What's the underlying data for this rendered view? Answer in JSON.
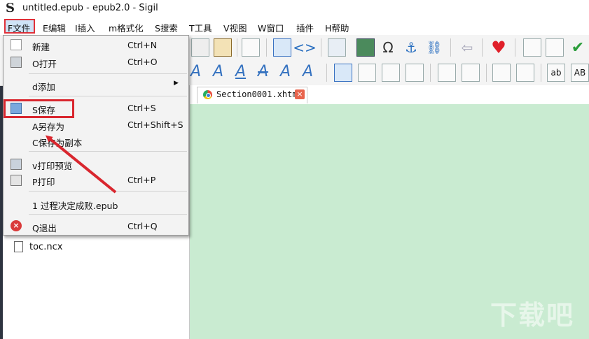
{
  "window": {
    "logo": "S",
    "title": "untitled.epub - epub2.0 - Sigil"
  },
  "menubar": {
    "items": [
      "F文件",
      "E编辑",
      "I插入",
      "m格式化",
      "S搜索",
      "T工具",
      "V视图",
      "W窗口",
      "插件",
      "H帮助"
    ]
  },
  "file_menu": {
    "items": [
      {
        "label": "新建",
        "shortcut": "Ctrl+N"
      },
      {
        "label": "O打开",
        "shortcut": "Ctrl+O"
      },
      {
        "label": "d添加",
        "shortcut": "▶"
      },
      {
        "label": "S保存",
        "shortcut": "Ctrl+S"
      },
      {
        "label": "A另存为",
        "shortcut": "Ctrl+Shift+S"
      },
      {
        "label": "C保存为副本",
        "shortcut": ""
      },
      {
        "label": "v打印预览",
        "shortcut": ""
      },
      {
        "label": "P打印",
        "shortcut": "Ctrl+P"
      },
      {
        "label": "1 过程决定成败.epub",
        "shortcut": ""
      },
      {
        "label": "Q退出",
        "shortcut": "Ctrl+Q"
      }
    ]
  },
  "toolbar2": {
    "text_buttons": [
      "ab",
      "AB"
    ]
  },
  "book_browser": {
    "files": [
      "toc.ncx"
    ]
  },
  "editor": {
    "tab_label": "Section0001.xhtml",
    "tab_close": "×"
  },
  "watermark": "下载吧",
  "colors": {
    "editor_bg": "#c9ebd1",
    "highlight": "#d9262e",
    "accent": "#2a6fc0"
  }
}
